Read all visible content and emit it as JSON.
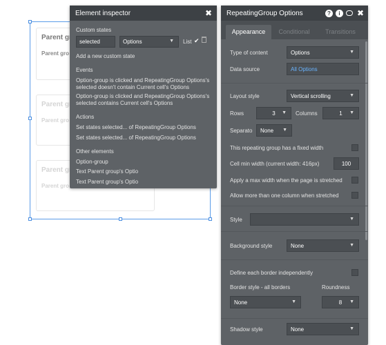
{
  "canvas": {
    "cards": [
      {
        "title": "Parent grou",
        "sub": "Parent gro"
      },
      {
        "title": "Parent grou",
        "sub": "Parent gro"
      },
      {
        "title": "Parent grou",
        "sub": "Parent gro"
      }
    ]
  },
  "inspector": {
    "title": "Element inspector",
    "custom_states_label": "Custom states",
    "state_name": "selected",
    "state_type": "Options",
    "list_label": "List",
    "add_state": "Add a new custom state",
    "events_label": "Events",
    "events": [
      "Option-group is clicked and RepeatingGroup Options's selected doesn't contain Current cell's Options",
      "Option-group is clicked and RepeatingGroup Options's selected contains Current cell's Options"
    ],
    "actions_label": "Actions",
    "actions": [
      "Set states selected... of RepeatingGroup Options",
      "Set states selected... of RepeatingGroup Options"
    ],
    "other_label": "Other elements",
    "others": [
      "Option-group",
      "Text Parent group's Optio",
      "Text Parent group's Optio"
    ]
  },
  "options": {
    "title": "RepeatingGroup Options",
    "tabs": [
      "Appearance",
      "Conditional",
      "Transitions"
    ],
    "type_label": "Type of content",
    "type_value": "Options",
    "source_label": "Data source",
    "source_value": "All Options",
    "layout_label": "Layout style",
    "layout_value": "Vertical scrolling",
    "rows_label": "Rows",
    "rows_value": "3",
    "cols_label": "Columns",
    "cols_value": "1",
    "separator_label": "Separato",
    "separator_value": "None",
    "fixed_width_label": "This repeating group has a fixed width",
    "min_width_label": "Cell min width (current width: 416px)",
    "min_width_value": "100",
    "max_width_label": "Apply a max width when the page is stretched",
    "multi_col_label": "Allow more than one column when stretched",
    "style_label": "Style",
    "style_value": "",
    "bg_label": "Background style",
    "bg_value": "None",
    "border_indep_label": "Define each border independently",
    "border_style_label": "Border style - all borders",
    "border_style_value": "None",
    "roundness_label": "Roundness",
    "roundness_value": "8",
    "shadow_label": "Shadow style",
    "shadow_value": "None"
  }
}
